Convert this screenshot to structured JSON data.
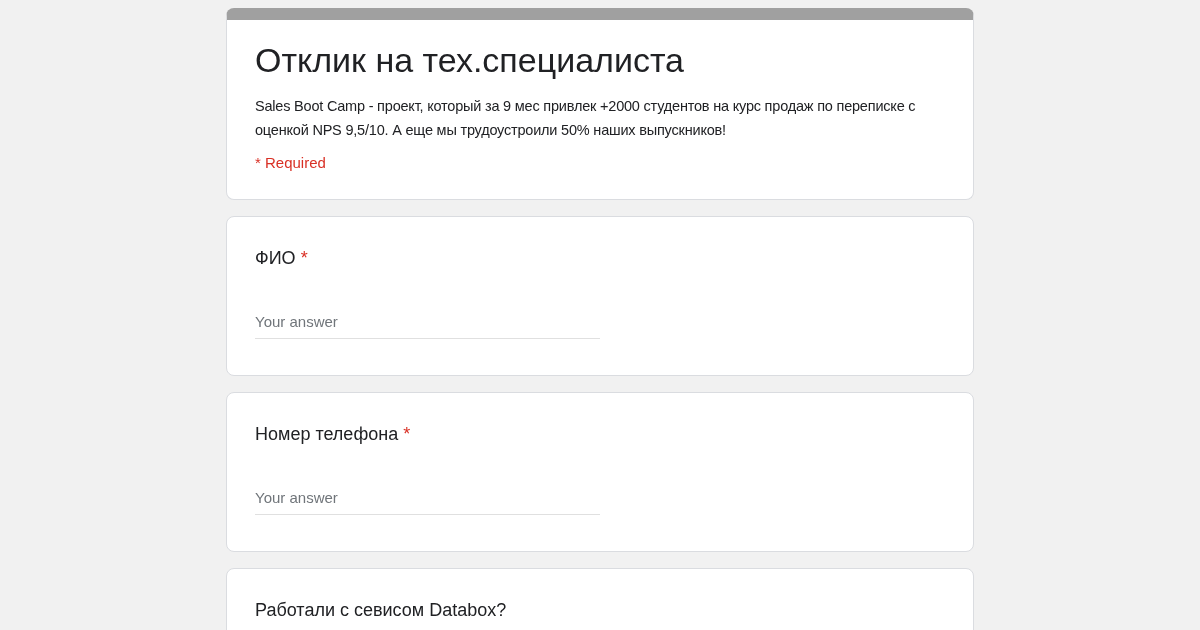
{
  "header": {
    "title": "Отклик на тех.специалиста",
    "description": "Sales Boot Camp - проект, который за 9 мес привлек +2000 студентов на курс продаж по переписке с оценкой NPS 9,5/10. А еще мы трудоустроили 50% наших выпускников!",
    "required_note": "* Required"
  },
  "questions": [
    {
      "label": "ФИО",
      "required_mark": "*",
      "placeholder": "Your answer"
    },
    {
      "label": "Номер телефона",
      "required_mark": "*",
      "placeholder": "Your answer"
    },
    {
      "label": "Работали с севисом Databox?"
    }
  ]
}
